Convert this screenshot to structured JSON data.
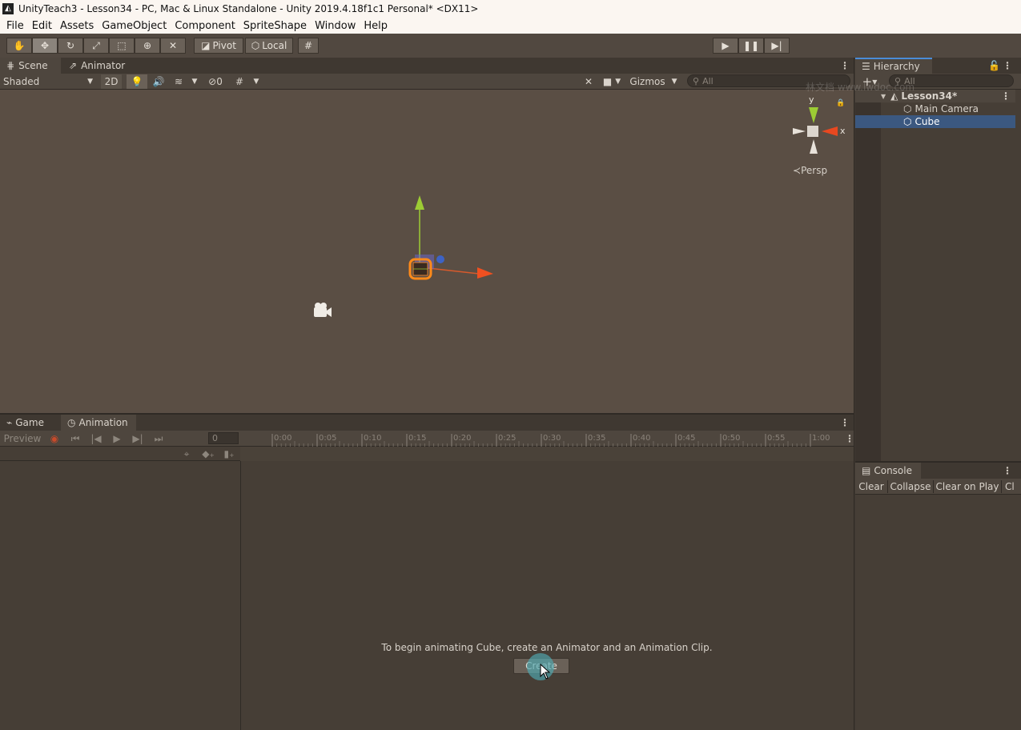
{
  "window": {
    "title": "UnityTeach3 - Lesson34 - PC, Mac & Linux Standalone - Unity 2019.4.18f1c1 Personal* <DX11>"
  },
  "menu": [
    "File",
    "Edit",
    "Assets",
    "GameObject",
    "Component",
    "SpriteShape",
    "Window",
    "Help"
  ],
  "toolbar": {
    "pivot": "Pivot",
    "local": "Local"
  },
  "scene_tabs": {
    "scene": "Scene",
    "animator": "Animator"
  },
  "scene_bar": {
    "shading": "Shaded",
    "mode_2d": "2D",
    "hidden_count": "0",
    "gizmos": "Gizmos",
    "search_placeholder": "All"
  },
  "gizmo": {
    "y": "y",
    "x": "x",
    "persp": "Persp"
  },
  "bottom_tabs": {
    "game": "Game",
    "animation": "Animation"
  },
  "animation": {
    "preview": "Preview",
    "frame": "0",
    "ticks": [
      "0:00",
      "0:05",
      "0:10",
      "0:15",
      "0:20",
      "0:25",
      "0:30",
      "0:35",
      "0:40",
      "0:45",
      "0:50",
      "0:55",
      "1:00"
    ],
    "message": "To begin animating Cube, create an Animator and an Animation Clip.",
    "create": "Create"
  },
  "hierarchy": {
    "title": "Hierarchy",
    "search_placeholder": "All",
    "scene": "Lesson34*",
    "items": [
      {
        "label": "Main Camera"
      },
      {
        "label": "Cube"
      }
    ]
  },
  "console": {
    "title": "Console",
    "buttons": [
      "Clear",
      "Collapse",
      "Clear on Play",
      "Cl"
    ]
  },
  "watermark": "林文档 www.lwdoc.com"
}
